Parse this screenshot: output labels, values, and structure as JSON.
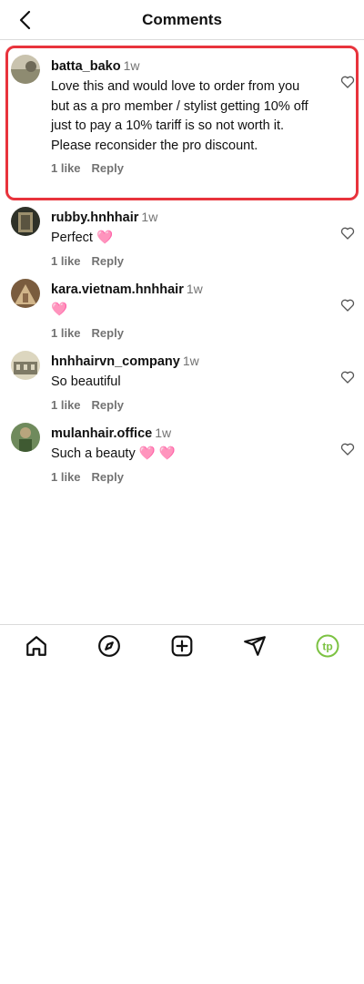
{
  "header": {
    "title": "Comments"
  },
  "comments": [
    {
      "username": "batta_bako",
      "time": "1w",
      "text": "Love this and would love to order from you but as a pro member / stylist getting 10% off just to pay a 10% tariff is so not worth it. Please reconsider the pro discount.",
      "likes": "1 like",
      "reply": "Reply",
      "avatar_colors": [
        "#a9a08c",
        "#6f6a58"
      ]
    },
    {
      "username": "rubby.hnhhair",
      "time": "1w",
      "text": "Perfect 🩷",
      "likes": "1 like",
      "reply": "Reply",
      "avatar_colors": [
        "#3b3f35",
        "#9b8f6d"
      ]
    },
    {
      "username": "kara.vietnam.hnhhair",
      "time": "1w",
      "text": "🩷",
      "likes": "1 like",
      "reply": "Reply",
      "avatar_colors": [
        "#8b6a4a",
        "#d1b58a"
      ]
    },
    {
      "username": "hnhhairvn_company",
      "time": "1w",
      "text": "So beautiful",
      "likes": "1 like",
      "reply": "Reply",
      "avatar_colors": [
        "#c9c2a7",
        "#7e7a66"
      ]
    },
    {
      "username": "mulanhair.office",
      "time": "1w",
      "text": "Such a beauty 🩷 🩷",
      "likes": "1 like",
      "reply": "Reply",
      "avatar_colors": [
        "#5c7a4a",
        "#b8a57d"
      ]
    }
  ],
  "tabbar": {
    "items": [
      "home-icon",
      "explore-icon",
      "new-post-icon",
      "direct-icon",
      "profile-icon"
    ],
    "profile_badge_text": "tp",
    "profile_badge_color": "#7cc242"
  },
  "colors": {
    "highlight": "#e8333c",
    "muted": "#737373"
  }
}
